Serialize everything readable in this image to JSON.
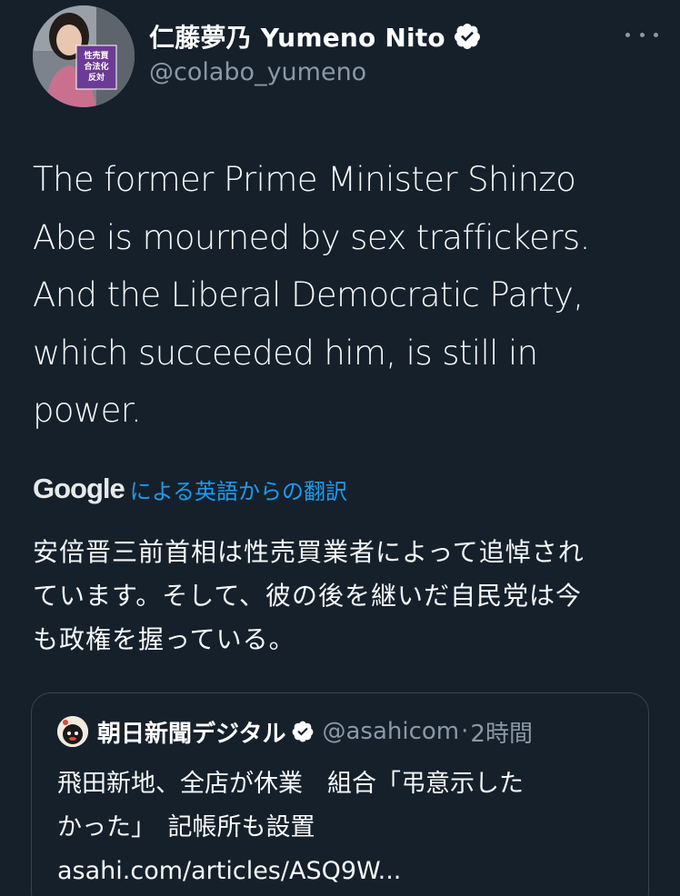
{
  "author": {
    "display_name": "仁藤夢乃  Yumeno Nito",
    "handle": "@colabo_yumeno",
    "avatar_sign_text": "性売買\n合法化\n反対"
  },
  "tweet": {
    "text": "The former Prime Minister Shinzo\nAbe is mourned by sex traffickers.\nAnd the Liberal Democratic Party,\nwhich succeeded him, is still in\npower."
  },
  "translation": {
    "brand": "Google",
    "label": "による英語からの翻訳",
    "text": "安倍晋三前首相は性売買業者によって追悼され\nています。そして、彼の後を継いだ自民党は今\nも政権を握っている。"
  },
  "quote": {
    "name": "朝日新聞デジタル",
    "handle": "@asahicom",
    "dot": "·",
    "time": "2時間",
    "text": "飛田新地、全店が休業　組合「弔意示した\nかった」　記帳所も設置",
    "link": "asahi.com/articles/ASQ9W..."
  },
  "colors": {
    "background": "#15202b",
    "accent": "#1d9bf0",
    "secondary_text": "#8b98a5",
    "border": "#38444d"
  }
}
